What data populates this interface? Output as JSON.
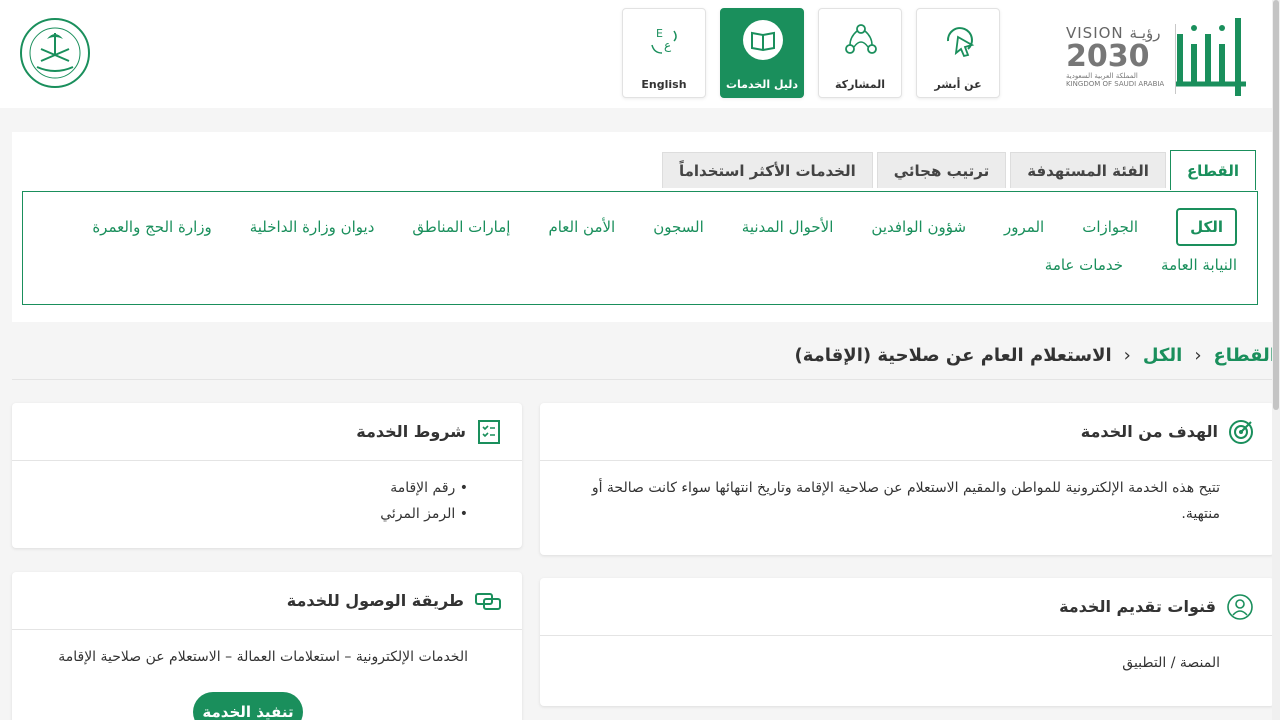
{
  "header": {
    "nav": [
      {
        "label": "English",
        "icon": "language-icon"
      },
      {
        "label": "دليل الخدمات",
        "icon": "book-icon",
        "active": true
      },
      {
        "label": "المشاركة",
        "icon": "network-icon"
      },
      {
        "label": "عن أبشر",
        "icon": "cursor-icon"
      }
    ],
    "vision": {
      "title": "VISION رؤيـة",
      "year": "2030",
      "sub_ar": "المملكة العربية السعودية",
      "sub_en": "KINGDOM OF SAUDI ARABIA"
    },
    "absher_logo": "أبشر"
  },
  "tabs": [
    {
      "label": "القطاع",
      "active": true
    },
    {
      "label": "الفئة المستهدفة"
    },
    {
      "label": "ترتيب هجائي"
    },
    {
      "label": "الخدمات الأكثر استخداماً"
    }
  ],
  "filters": {
    "row1": [
      "الكل",
      "الجوازات",
      "المرور",
      "شؤون الوافدين",
      "الأحوال المدنية",
      "السجون",
      "الأمن العام",
      "إمارات المناطق",
      "ديوان وزارة الداخلية",
      "وزارة الحج والعمرة"
    ],
    "row2": [
      "النيابة العامة",
      "خدمات عامة"
    ]
  },
  "breadcrumb": {
    "root": "القطاع",
    "mid": "الكل",
    "current": "الاستعلام العام عن صلاحية (الإقامة)"
  },
  "cards": {
    "goal": {
      "title": "الهدف من الخدمة",
      "text": "تتيح هذه الخدمة الإلكترونية للمواطن والمقيم الاستعلام عن صلاحية الإقامة وتاريخ انتهائها سواء كانت صالحة أو منتهية."
    },
    "conditions": {
      "title": "شروط الخدمة",
      "items": [
        "رقم الإقامة",
        "الرمز المرئي"
      ]
    },
    "channels": {
      "title": "قنوات تقديم الخدمة",
      "text": "المنصة / التطبيق"
    },
    "access": {
      "title": "طريقة الوصول للخدمة",
      "text": "الخدمات الإلكترونية – استعلامات العمالة – الاستعلام عن صلاحية الإقامة",
      "button": "تنفيذ الخدمة"
    }
  },
  "colors": {
    "accent": "#1a8f5c"
  }
}
